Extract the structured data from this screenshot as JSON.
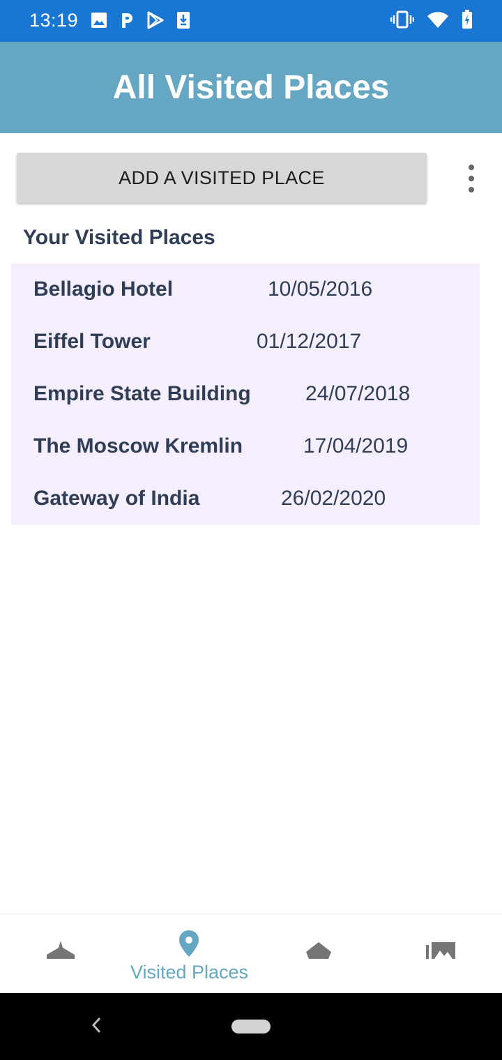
{
  "status_bar": {
    "time": "13:19",
    "left_icons": [
      "image-icon",
      "parking-icon",
      "play-store-icon",
      "download-icon"
    ],
    "right_icons": [
      "vibrate-icon",
      "wifi-icon",
      "battery-charging-icon"
    ]
  },
  "app_bar": {
    "title": "All Visited Places"
  },
  "actions": {
    "add_label": "ADD A VISITED PLACE"
  },
  "list": {
    "heading": "Your Visited Places",
    "places": [
      {
        "name": "Bellagio Hotel",
        "date": "10/05/2016"
      },
      {
        "name": "Eiffel Tower",
        "date": "01/12/2017"
      },
      {
        "name": "Empire State Building",
        "date": "24/07/2018"
      },
      {
        "name": "The Moscow Kremlin",
        "date": "17/04/2019"
      },
      {
        "name": "Gateway of India",
        "date": "26/02/2020"
      }
    ]
  },
  "bottom_nav": {
    "items": [
      {
        "icon": "airplane-icon",
        "label": ""
      },
      {
        "icon": "location-pin-icon",
        "label": "Visited Places",
        "active": true
      },
      {
        "icon": "layers-icon",
        "label": ""
      },
      {
        "icon": "photo-album-icon",
        "label": ""
      }
    ]
  },
  "colors": {
    "status_bar": "#1976d2",
    "app_bar": "#65a7c2",
    "accent": "#65a7c2",
    "list_background": "#f5effd",
    "text_primary": "#2f3e56",
    "button_background": "#d6d7d7"
  }
}
